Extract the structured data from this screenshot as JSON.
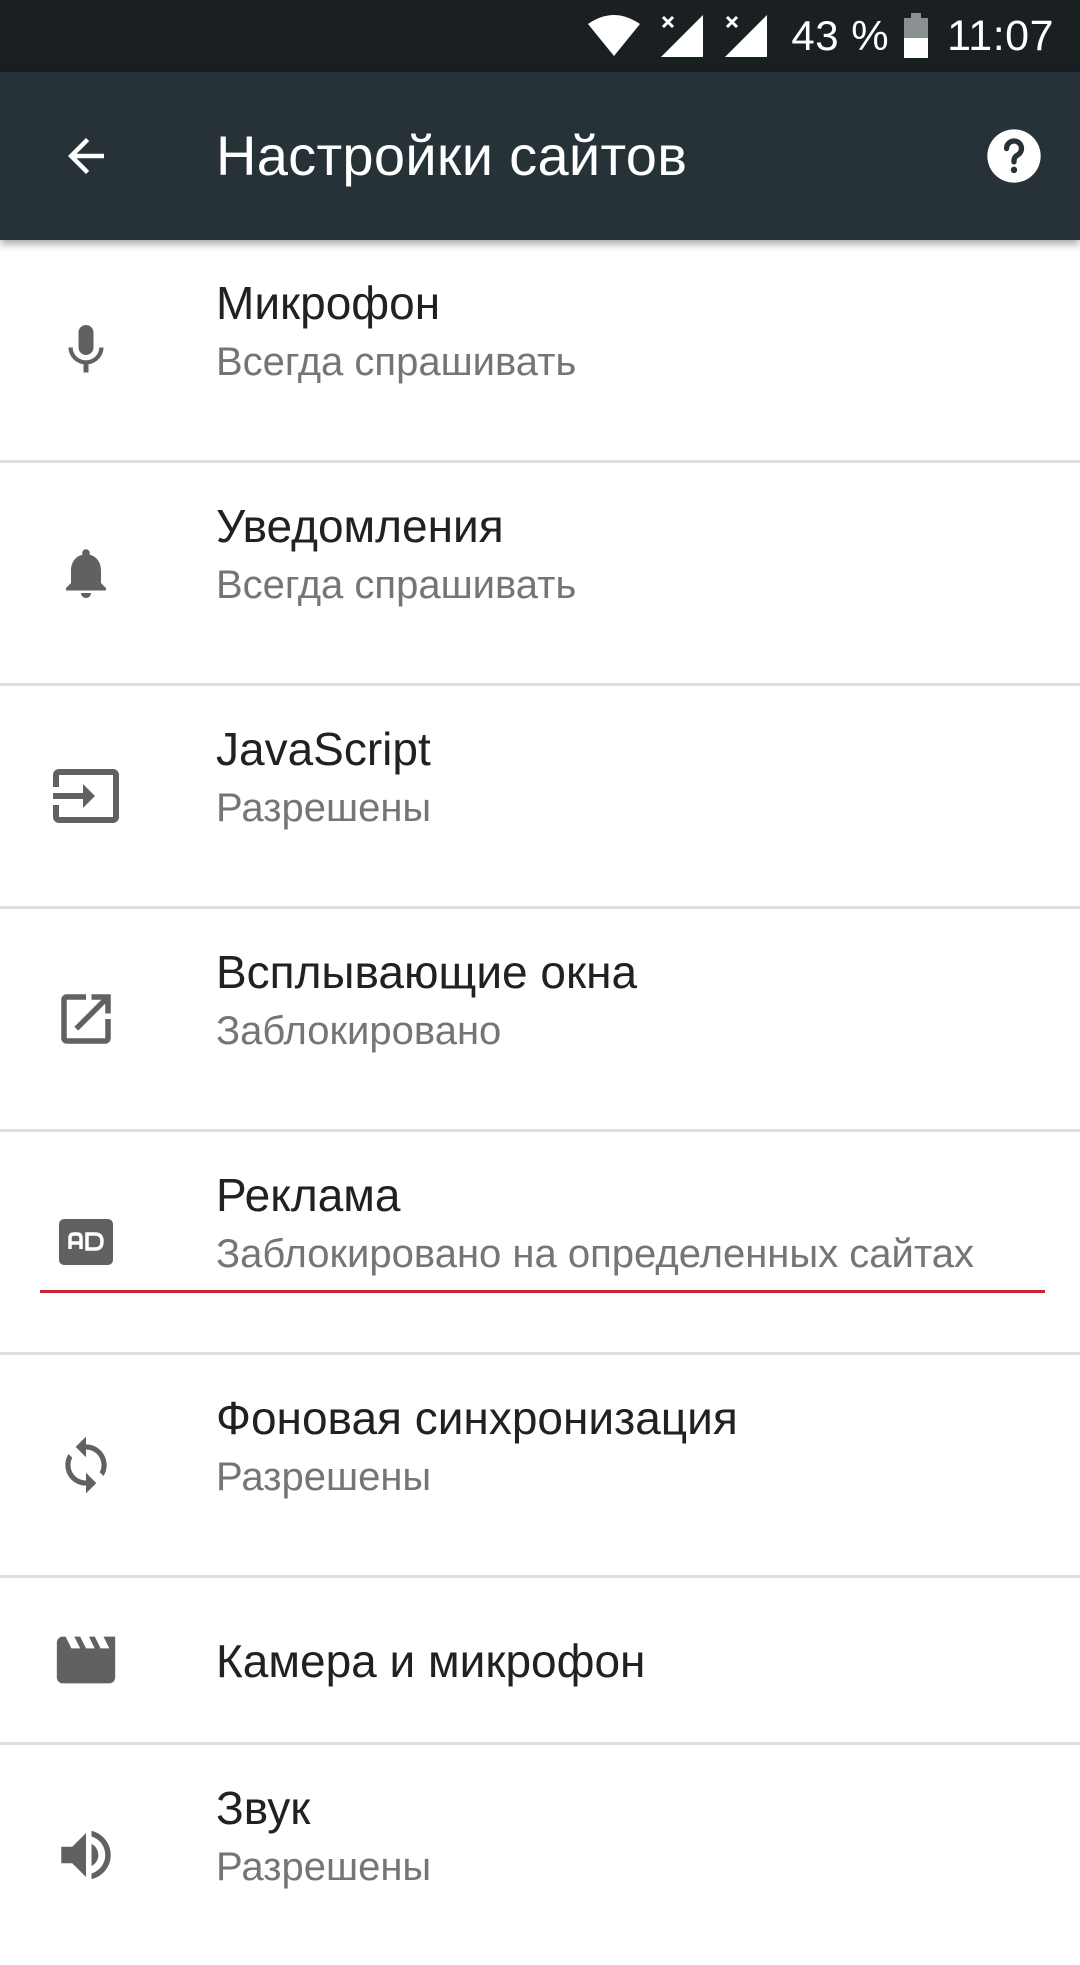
{
  "status_bar": {
    "battery_percent": "43 %",
    "time": "11:07",
    "icons": [
      "wifi-icon",
      "signal-no-sim-icon",
      "signal-no-sim-icon",
      "battery-icon"
    ]
  },
  "app_bar": {
    "title": "Настройки сайтов",
    "back_icon": "arrow-back-icon",
    "help_icon": "help-icon"
  },
  "items": [
    {
      "icon": "microphone-icon",
      "title": "Микрофон",
      "summary": "Всегда спрашивать"
    },
    {
      "icon": "bell-icon",
      "title": "Уведомления",
      "summary": "Всегда спрашивать"
    },
    {
      "icon": "input-arrow-icon",
      "title": "JavaScript",
      "summary": "Разрешены"
    },
    {
      "icon": "open-in-new-icon",
      "title": "Всплывающие окна",
      "summary": "Заблокировано"
    },
    {
      "icon": "ad-icon",
      "title": "Реклама",
      "summary": "Заблокировано на определенных сайтах"
    },
    {
      "icon": "sync-icon",
      "title": "Фоновая синхронизация",
      "summary": "Разрешены"
    },
    {
      "icon": "clapperboard-icon",
      "title": "Камера и микрофон"
    },
    {
      "icon": "speaker-icon",
      "title": "Звук",
      "summary": "Разрешены"
    }
  ],
  "colors": {
    "status_bar_bg": "#1a1f22",
    "app_bar_bg": "#263238",
    "accent": "#c62838",
    "icon_color": "#616161",
    "primary_text": "#212121",
    "secondary_text": "#757575"
  }
}
